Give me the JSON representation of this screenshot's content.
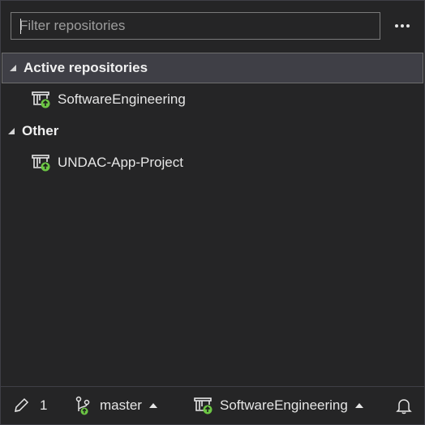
{
  "filter": {
    "placeholder": "Filter repositories"
  },
  "groups": [
    {
      "label": "Active repositories",
      "repos": [
        "SoftwareEngineering"
      ]
    },
    {
      "label": "Other",
      "repos": [
        "UNDAC-App-Project"
      ]
    }
  ],
  "statusbar": {
    "pending_changes": "1",
    "branch": "master",
    "repository": "SoftwareEngineering"
  },
  "icons": {
    "more": "more-options-icon",
    "repo": "repository-icon",
    "pencil": "pencil-icon",
    "branch": "branch-icon",
    "bell": "bell-icon"
  },
  "colors": {
    "accent_green": "#6cc644",
    "background": "#252526"
  }
}
